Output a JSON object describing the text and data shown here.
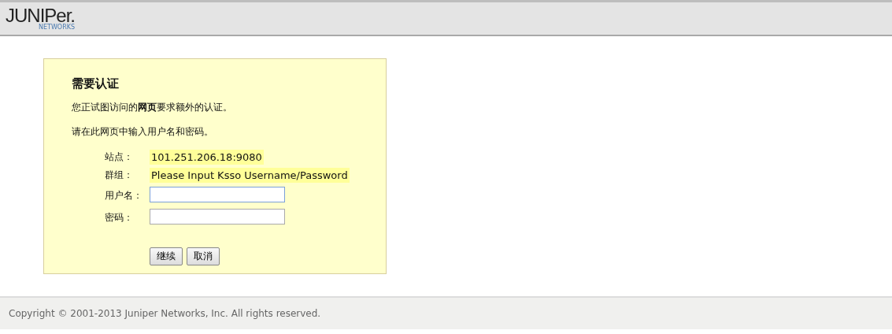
{
  "header": {
    "logo": {
      "name": "JUNIPer.",
      "tagline": "NETWORKS"
    }
  },
  "dialog": {
    "title": "需要认证",
    "message": "您正试图访问的**网页**要求额外的认证。",
    "instruction": "请在此网页中输入用户名和密码。",
    "info": [
      {
        "label": "站点：",
        "value": "101.251.206.18:9080"
      },
      {
        "label": "群组：",
        "value": "Please Input Ksso Username/Password"
      }
    ],
    "fields": [
      {
        "label": "用户名：",
        "focused": true
      },
      {
        "label": "密码：",
        "focused": false
      }
    ],
    "buttons": [
      "继续",
      "取消"
    ]
  },
  "footer": {
    "copyright": "Copyright © 2001-2013 Juniper Networks, Inc. All rights reserved."
  }
}
